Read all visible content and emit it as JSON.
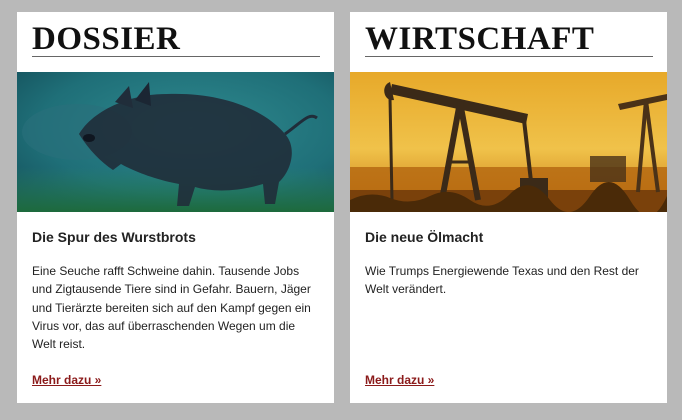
{
  "teasers": [
    {
      "section": "DOSSIER",
      "headline": "Die Spur des Wurstbrots",
      "body": "Eine Seuche rafft Schweine dahin. Tausende Jobs und Zigtausende Tiere sind in Gefahr. Bauern, Jäger und Tierärzte bereiten sich auf den Kampf gegen ein Virus vor, das auf überraschenden Wegen um die Welt reist.",
      "link": "Mehr dazu »",
      "image": "wild-boar-photo"
    },
    {
      "section": "WIRTSCHAFT",
      "headline": "Die neue Ölmacht",
      "body": "Wie Trumps Energiewende Texas und den Rest der Welt verändert.",
      "link": "Mehr dazu »",
      "image": "oil-pumpjack-photo"
    }
  ],
  "colors": {
    "page_background": "#b9b9b9",
    "card_background": "#ffffff",
    "link": "#8b1a1a"
  }
}
